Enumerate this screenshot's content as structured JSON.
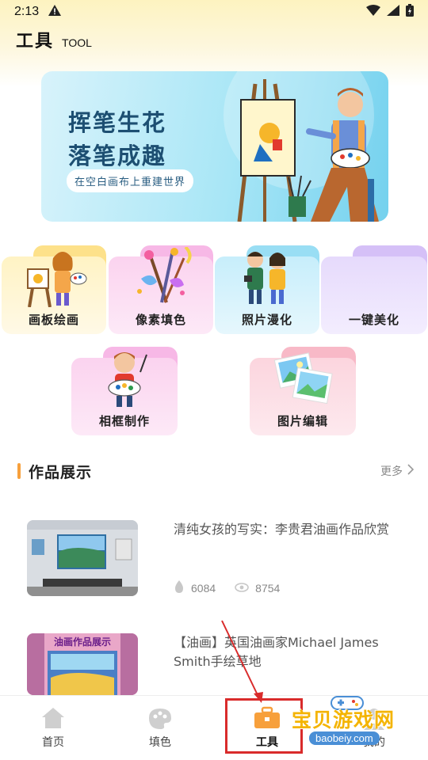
{
  "status_bar": {
    "time": "2:13"
  },
  "header": {
    "title": "工具",
    "subtitle": "TOOL"
  },
  "banner": {
    "line1": "挥笔生花",
    "line2": "落笔成趣",
    "tagline": "在空白画布上重建世界"
  },
  "tools": [
    {
      "label": "画板绘画"
    },
    {
      "label": "像素填色"
    },
    {
      "label": "照片漫化"
    },
    {
      "label": "一键美化"
    },
    {
      "label": "相框制作"
    },
    {
      "label": "图片编辑"
    }
  ],
  "works_section": {
    "title": "作品展示",
    "more": "更多"
  },
  "works": [
    {
      "title": "清纯女孩的写实：李贵君油画作品欣赏",
      "likes": "6084",
      "views": "8754"
    },
    {
      "title": "【油画】英国油画家Michael James Smith手绘草地",
      "thumb_text": "油画作品展示"
    }
  ],
  "tabbar": {
    "items": [
      "首页",
      "填色",
      "工具",
      "我的"
    ]
  },
  "watermark": {
    "text": "宝贝游戏网",
    "url": "baobeiy.com"
  }
}
